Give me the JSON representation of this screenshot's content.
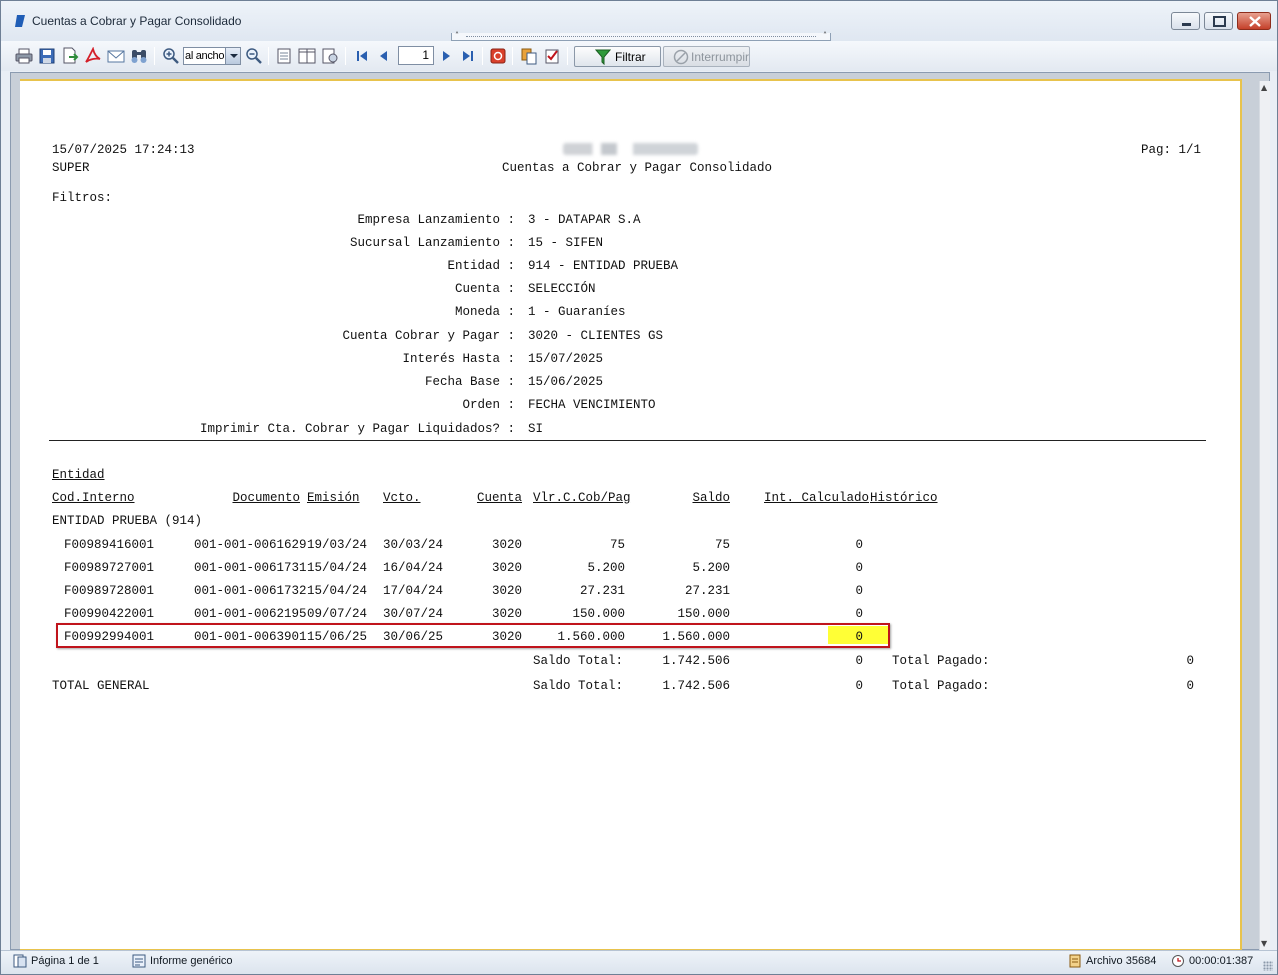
{
  "window": {
    "title": "Cuentas a Cobrar y Pagar Consolidado"
  },
  "toolbar": {
    "icons": [
      "print-icon",
      "save-icon",
      "export-icon",
      "pdf-icon",
      "email-icon",
      "find-icon",
      "zoom-in-icon",
      "zoom-out-icon",
      "one-page-icon",
      "two-page-icon",
      "page-setup-icon",
      "first-page-icon",
      "prev-page-icon",
      "next-page-icon",
      "last-page-icon",
      "stop-icon",
      "copy-icon",
      "properties-icon"
    ],
    "zoom_value": "al ancho",
    "page_number": "1",
    "filter_label": "Filtrar",
    "interrupt_label": "Interrumpir"
  },
  "report": {
    "datetime": "15/07/2025 17:24:13",
    "user": "SUPER",
    "title": "Cuentas a Cobrar y Pagar Consolidado",
    "page": "Pag: 1/1",
    "filters_heading": "Filtros:",
    "filters": [
      {
        "label": "Empresa Lanzamiento :",
        "value": "3 - DATAPAR S.A"
      },
      {
        "label": "Sucursal Lanzamiento :",
        "value": "15 - SIFEN"
      },
      {
        "label": "Entidad :",
        "value": "914 - ENTIDAD PRUEBA"
      },
      {
        "label": "Cuenta :",
        "value": "SELECCIÓN"
      },
      {
        "label": "Moneda :",
        "value": "1 - Guaraníes"
      },
      {
        "label": "Cuenta Cobrar y Pagar :",
        "value": "3020 - CLIENTES GS"
      },
      {
        "label": "Interés Hasta :",
        "value": "15/07/2025"
      },
      {
        "label": "Fecha Base :",
        "value": "15/06/2025"
      },
      {
        "label": "Orden :",
        "value": "FECHA VENCIMIENTO"
      },
      {
        "label": "Imprimir Cta. Cobrar y Pagar Liquidados? :",
        "value": "SI"
      }
    ],
    "group_heading": "Entidad",
    "columns": {
      "cod_interno": "Cod.Interno",
      "documento": "Documento",
      "emision": "Emisión",
      "vcto": "Vcto.",
      "cuenta": "Cuenta",
      "vlr": "Vlr.C.Cob/Pag",
      "saldo": "Saldo",
      "int_calc": "Int. Calculado",
      "historico": "Histórico"
    },
    "entity_name": "ENTIDAD PRUEBA (914)",
    "rows": [
      {
        "cod": "F00989416001",
        "doc": "001-001-0061629",
        "emision": "19/03/24",
        "vcto": "30/03/24",
        "cuenta": "3020",
        "vlr": "75",
        "saldo": "75",
        "interes": "0"
      },
      {
        "cod": "F00989727001",
        "doc": "001-001-0061731",
        "emision": "15/04/24",
        "vcto": "16/04/24",
        "cuenta": "3020",
        "vlr": "5.200",
        "saldo": "5.200",
        "interes": "0"
      },
      {
        "cod": "F00989728001",
        "doc": "001-001-0061732",
        "emision": "15/04/24",
        "vcto": "17/04/24",
        "cuenta": "3020",
        "vlr": "27.231",
        "saldo": "27.231",
        "interes": "0"
      },
      {
        "cod": "F00990422001",
        "doc": "001-001-0062195",
        "emision": "09/07/24",
        "vcto": "30/07/24",
        "cuenta": "3020",
        "vlr": "150.000",
        "saldo": "150.000",
        "interes": "0"
      },
      {
        "cod": "F00992994001",
        "doc": "001-001-0063901",
        "emision": "15/06/25",
        "vcto": "30/06/25",
        "cuenta": "3020",
        "vlr": "1.560.000",
        "saldo": "1.560.000",
        "interes": "0"
      }
    ],
    "subtotal": {
      "label": "Saldo Total:",
      "saldo": "1.742.506",
      "interes": "0",
      "pagado_label": "Total Pagado:",
      "pagado": "0"
    },
    "total_general": {
      "name": "TOTAL GENERAL",
      "label": "Saldo Total:",
      "saldo": "1.742.506",
      "interes": "0",
      "pagado_label": "Total Pagado:",
      "pagado": "0"
    }
  },
  "status": {
    "page_info": "Página 1 de 1",
    "report_type": "Informe genérico",
    "archive": "Archivo 35684",
    "elapsed": "00:00:01:387"
  },
  "colors": {
    "highlight_border": "#c0141c",
    "highlight_fill": "#ffff36",
    "paper_border": "#e8c34d"
  }
}
